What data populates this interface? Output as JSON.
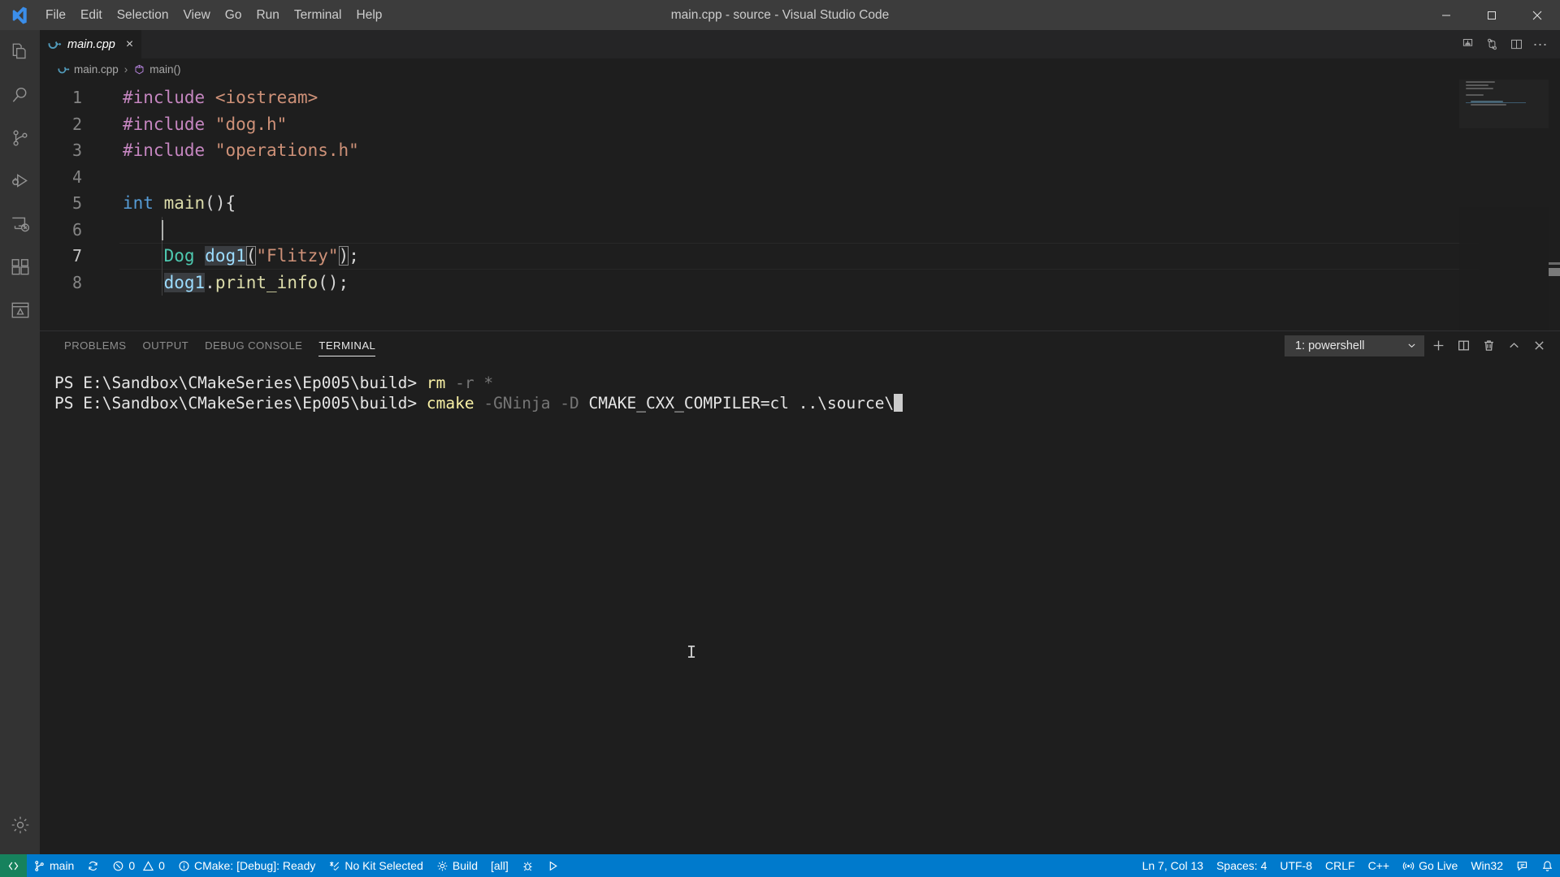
{
  "window": {
    "title": "main.cpp - source - Visual Studio Code",
    "minimize_label": "Minimize",
    "maximize_label": "Maximize",
    "close_label": "Close"
  },
  "menubar": {
    "items": [
      {
        "label": "File"
      },
      {
        "label": "Edit"
      },
      {
        "label": "Selection"
      },
      {
        "label": "View"
      },
      {
        "label": "Go"
      },
      {
        "label": "Run"
      },
      {
        "label": "Terminal"
      },
      {
        "label": "Help"
      }
    ]
  },
  "activitybar": {
    "items": [
      {
        "name": "explorer",
        "icon": "files-icon",
        "title": "Explorer"
      },
      {
        "name": "search",
        "icon": "search-icon",
        "title": "Search"
      },
      {
        "name": "source-control",
        "icon": "source-control-icon",
        "title": "Source Control"
      },
      {
        "name": "run-debug",
        "icon": "run-and-debug-icon",
        "title": "Run and Debug"
      },
      {
        "name": "remote-explorer",
        "icon": "remote-explorer-icon",
        "title": "Remote Explorer"
      },
      {
        "name": "extensions",
        "icon": "extensions-icon",
        "title": "Extensions"
      },
      {
        "name": "cmake",
        "icon": "cmake-icon",
        "title": "CMake"
      }
    ],
    "bottom": [
      {
        "name": "manage",
        "icon": "gear-icon",
        "title": "Manage"
      }
    ]
  },
  "tabs": {
    "open": [
      {
        "label": "main.cpp",
        "icon": "cpp-file-icon",
        "close_label": "×",
        "active": true
      }
    ],
    "actions": [
      {
        "name": "run-code",
        "icon": "run-code-icon"
      },
      {
        "name": "source-control-graph",
        "icon": "git-compare-icon"
      },
      {
        "name": "split-editor",
        "icon": "split-editor-icon"
      },
      {
        "name": "more-actions",
        "icon": "ellipsis-icon",
        "glyph": "⋯"
      }
    ]
  },
  "breadcrumb": {
    "items": [
      {
        "label": "main.cpp",
        "icon": "cpp-file-icon"
      },
      {
        "label": "main()",
        "icon": "symbol-method-icon"
      }
    ],
    "separator": "›"
  },
  "editor": {
    "language": "cpp",
    "lines": [
      {
        "number": "1",
        "tokens": [
          {
            "text": "#include",
            "cls": "t-pre"
          },
          {
            "text": " ",
            "cls": "t-plain"
          },
          {
            "text": "<iostream>",
            "cls": "t-str"
          }
        ]
      },
      {
        "number": "2",
        "tokens": [
          {
            "text": "#include",
            "cls": "t-pre"
          },
          {
            "text": " ",
            "cls": "t-plain"
          },
          {
            "text": "\"dog.h\"",
            "cls": "t-str"
          }
        ]
      },
      {
        "number": "3",
        "tokens": [
          {
            "text": "#include",
            "cls": "t-pre"
          },
          {
            "text": " ",
            "cls": "t-plain"
          },
          {
            "text": "\"operations.h\"",
            "cls": "t-str"
          }
        ]
      },
      {
        "number": "4",
        "tokens": []
      },
      {
        "number": "5",
        "tokens": [
          {
            "text": "int",
            "cls": "t-kw"
          },
          {
            "text": " ",
            "cls": "t-plain"
          },
          {
            "text": "main",
            "cls": "t-fn"
          },
          {
            "text": "(){",
            "cls": "t-plain"
          }
        ]
      },
      {
        "number": "6",
        "tokens": []
      },
      {
        "number": "7",
        "current": true,
        "tokens": [
          {
            "text": "    ",
            "cls": "t-plain"
          },
          {
            "text": "Dog",
            "cls": "t-type"
          },
          {
            "text": " ",
            "cls": "t-plain"
          },
          {
            "text": "dog1",
            "cls": "t-var sel-soft"
          },
          {
            "text": "(",
            "cls": "t-plain bracket-box"
          },
          {
            "text": "\"Flitzy\"",
            "cls": "t-str"
          },
          {
            "text": ")",
            "cls": "t-plain bracket-box"
          },
          {
            "text": ";",
            "cls": "t-plain"
          }
        ]
      },
      {
        "number": "8",
        "tokens": [
          {
            "text": "    ",
            "cls": "t-plain"
          },
          {
            "text": "dog1",
            "cls": "t-var sel-soft"
          },
          {
            "text": ".",
            "cls": "t-plain"
          },
          {
            "text": "print_info",
            "cls": "t-fn"
          },
          {
            "text": "();",
            "cls": "t-plain"
          }
        ]
      }
    ]
  },
  "panel": {
    "tabs": [
      {
        "label": "PROBLEMS",
        "active": false
      },
      {
        "label": "OUTPUT",
        "active": false
      },
      {
        "label": "DEBUG CONSOLE",
        "active": false
      },
      {
        "label": "TERMINAL",
        "active": true
      }
    ],
    "terminal_select": {
      "value": "1: powershell",
      "chevron": "⌄"
    },
    "actions": [
      {
        "name": "new-terminal",
        "icon": "plus-icon",
        "glyph": "+"
      },
      {
        "name": "split-terminal",
        "icon": "split-icon"
      },
      {
        "name": "kill-terminal",
        "icon": "trash-icon"
      },
      {
        "name": "maximize-panel",
        "icon": "chevron-up-icon",
        "glyph": "∧"
      },
      {
        "name": "close-panel",
        "icon": "close-icon",
        "glyph": "✕"
      }
    ]
  },
  "terminal": {
    "lines": [
      {
        "segments": [
          {
            "text": "PS E:\\Sandbox\\CMakeSeries\\Ep005\\build> ",
            "cls": "tc-white"
          },
          {
            "text": "rm",
            "cls": "tc-yellow"
          },
          {
            "text": " ",
            "cls": "tc-white"
          },
          {
            "text": "-r",
            "cls": "tc-dim"
          },
          {
            "text": " ",
            "cls": "tc-white"
          },
          {
            "text": "*",
            "cls": "tc-dim"
          }
        ]
      },
      {
        "segments": [
          {
            "text": "PS E:\\Sandbox\\CMakeSeries\\Ep005\\build> ",
            "cls": "tc-white"
          },
          {
            "text": "cmake",
            "cls": "tc-yellow"
          },
          {
            "text": " ",
            "cls": "tc-white"
          },
          {
            "text": "-GNinja",
            "cls": "tc-dim"
          },
          {
            "text": " ",
            "cls": "tc-white"
          },
          {
            "text": "-D",
            "cls": "tc-dim"
          },
          {
            "text": " ",
            "cls": "tc-white"
          },
          {
            "text": "CMAKE_CXX_COMPILER=cl ..\\source\\",
            "cls": "tc-white"
          }
        ],
        "cursor": true
      }
    ],
    "mouse_caret": "I"
  },
  "statusbar": {
    "left": [
      {
        "name": "remote-indicator",
        "icon": "remote-icon",
        "label": ""
      },
      {
        "name": "branch",
        "icon": "git-branch-icon",
        "label": "main"
      },
      {
        "name": "sync",
        "icon": "sync-icon",
        "label": ""
      },
      {
        "name": "problems",
        "icon": "error-warning-icon",
        "label": "0",
        "label2": "0"
      },
      {
        "name": "cmake-status",
        "icon": "info-icon",
        "label": "CMake: [Debug]: Ready"
      },
      {
        "name": "cmake-kit",
        "icon": "tools-icon",
        "label": "No Kit Selected"
      },
      {
        "name": "cmake-build",
        "icon": "gear-icon",
        "label": "Build"
      },
      {
        "name": "cmake-target",
        "icon": "",
        "label": "[all]"
      },
      {
        "name": "cmake-debug",
        "icon": "debug-icon",
        "label": ""
      },
      {
        "name": "cmake-run",
        "icon": "play-icon",
        "label": ""
      }
    ],
    "right": [
      {
        "name": "cursor-position",
        "label": "Ln 7, Col 13"
      },
      {
        "name": "indentation",
        "label": "Spaces: 4"
      },
      {
        "name": "encoding",
        "label": "UTF-8"
      },
      {
        "name": "eol",
        "label": "CRLF"
      },
      {
        "name": "language-mode",
        "label": "C++"
      },
      {
        "name": "go-live",
        "icon": "broadcast-icon",
        "label": "Go Live"
      },
      {
        "name": "platform",
        "label": "Win32"
      },
      {
        "name": "feedback",
        "icon": "feedback-icon",
        "label": ""
      },
      {
        "name": "notifications",
        "icon": "bell-icon",
        "label": ""
      }
    ]
  },
  "colors": {
    "accent": "#007acc",
    "remote_green": "#16825d",
    "titlebar": "#3c3c3c",
    "activitybar": "#333333",
    "editor_bg": "#1e1e1e",
    "tabbar_bg": "#252526"
  }
}
